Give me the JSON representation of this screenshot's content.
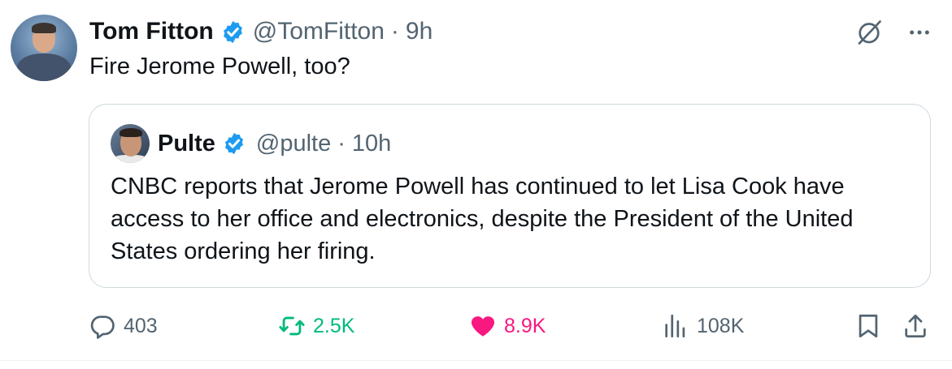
{
  "tweet": {
    "author_name": "Tom Fitton",
    "author_handle": "@TomFitton",
    "separator": "·",
    "time": "9h",
    "text": "Fire Jerome Powell, too?"
  },
  "quoted_tweet": {
    "author_name": "Pulte",
    "author_handle": "@pulte",
    "separator": "·",
    "time": "10h",
    "text": "CNBC reports that Jerome Powell has continued to let Lisa Cook have access to her office and electronics, despite the President of the United States ordering her firing."
  },
  "actions": {
    "replies": "403",
    "reposts": "2.5K",
    "likes": "8.9K",
    "views": "108K"
  },
  "icons": {
    "verified": "verified-badge-icon",
    "grok": "grok-icon",
    "more": "more-icon",
    "reply": "reply-icon",
    "repost": "repost-icon",
    "like": "heart-icon",
    "views": "views-icon",
    "bookmark": "bookmark-icon",
    "share": "share-icon"
  },
  "colors": {
    "verified": "#1d9bf0",
    "repost_active": "#00ba7c",
    "like_active": "#f91880",
    "muted": "#536471"
  }
}
